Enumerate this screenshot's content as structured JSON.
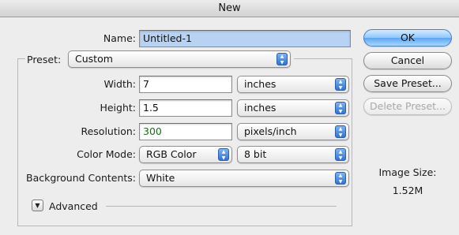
{
  "window": {
    "title": "New"
  },
  "form": {
    "name": {
      "label": "Name:",
      "value": "Untitled-1"
    },
    "preset": {
      "label": "Preset:",
      "value": "Custom"
    },
    "width": {
      "label": "Width:",
      "value": "7",
      "unit": "inches"
    },
    "height": {
      "label": "Height:",
      "value": "1.5",
      "unit": "inches"
    },
    "resolution": {
      "label": "Resolution:",
      "value": "300",
      "unit": "pixels/inch"
    },
    "color_mode": {
      "label": "Color Mode:",
      "value": "RGB Color",
      "depth": "8 bit"
    },
    "background": {
      "label": "Background Contents:",
      "value": "White"
    },
    "advanced": {
      "label": "Advanced"
    }
  },
  "buttons": {
    "ok": "OK",
    "cancel": "Cancel",
    "save_preset": "Save Preset...",
    "delete_preset": "Delete Preset..."
  },
  "image_size": {
    "label": "Image Size:",
    "value": "1.52M"
  },
  "icons": {
    "stepper": "up-down-arrows-icon",
    "disclosure": "triangle-down-icon"
  }
}
